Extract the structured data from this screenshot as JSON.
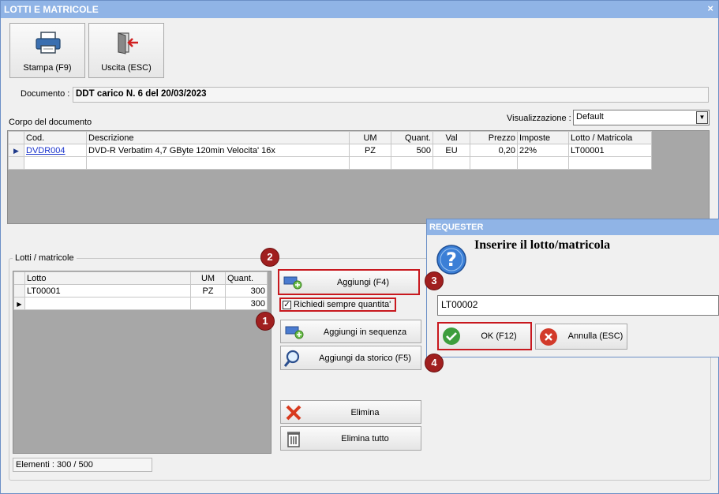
{
  "window": {
    "title": "LOTTI E MATRICOLE",
    "close": "×"
  },
  "toolbar": {
    "print_label": "Stampa (F9)",
    "exit_label": "Uscita (ESC)"
  },
  "document": {
    "label": "Documento :",
    "value": "DDT carico N. 6 del 20/03/2023"
  },
  "body_section": {
    "label": "Corpo del documento",
    "view_label": "Visualizzazione :",
    "view_value": "Default"
  },
  "doc_table": {
    "headers": [
      "Cod.",
      "Descrizione",
      "UM",
      "Quant.",
      "Val",
      "Prezzo",
      "Imposte",
      "Lotto / Matricola"
    ],
    "rows": [
      [
        "DVDR004",
        "DVD-R Verbatim 4,7 GByte 120min  Velocita' 16x",
        "PZ",
        "500",
        "EU",
        "0,20",
        "22%",
        "LT00001"
      ]
    ]
  },
  "lots": {
    "title": "Lotti / matricole",
    "headers": [
      "Lotto",
      "UM",
      "Quant."
    ],
    "rows": [
      [
        "LT00001",
        "PZ",
        "300"
      ],
      [
        "",
        "",
        "300"
      ]
    ],
    "status": "Elementi : 300 / 500"
  },
  "actions": {
    "add": "Aggiungi (F4)",
    "ask_qty": "Richiedi sempre quantita'",
    "ask_qty_checked": true,
    "add_seq": "Aggiungi in sequenza",
    "add_history": "Aggiungi da storico (F5)",
    "delete": "Elimina",
    "delete_all": "Elimina tutto"
  },
  "dialog": {
    "title": "REQUESTER",
    "prompt": "Inserire il lotto/matricola",
    "value": "LT00002",
    "ok": "OK (F12)",
    "cancel": "Annulla (ESC)"
  },
  "badges": [
    "1",
    "2",
    "3",
    "4"
  ],
  "colors": {
    "title_bar": "#90b4e6",
    "highlight": "#c8181e",
    "badge": "#a01f1f",
    "grid_bg": "#a7a7a7",
    "link": "#1a33cc"
  }
}
